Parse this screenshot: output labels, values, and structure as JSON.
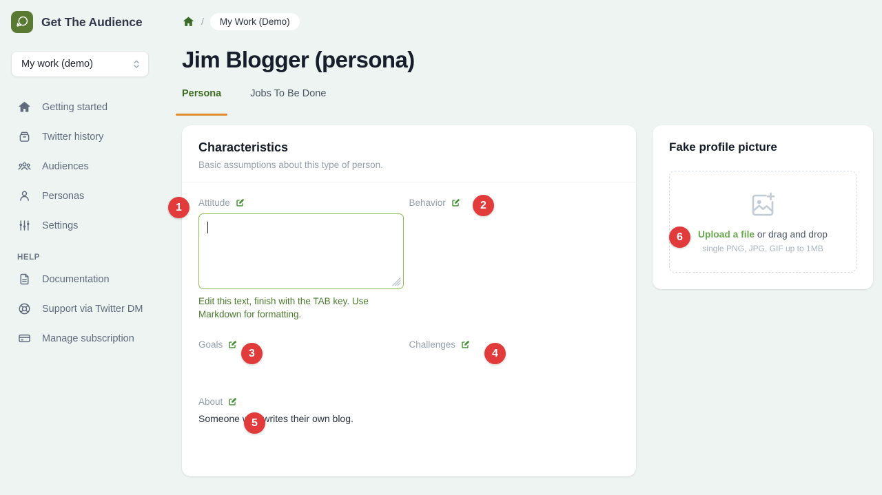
{
  "brand": {
    "name": "Get The Audience",
    "logo_icon": "speech-bubbles-icon",
    "logo_color": "#5a7a33"
  },
  "sidebar": {
    "workspace": {
      "value": "My work (demo)",
      "chevron_icon": "chevron-up-down-icon"
    },
    "items": [
      {
        "label": "Getting started",
        "icon": "home-icon"
      },
      {
        "label": "Twitter history",
        "icon": "archive-box-icon"
      },
      {
        "label": "Audiences",
        "icon": "user-group-icon"
      },
      {
        "label": "Personas",
        "icon": "user-icon"
      },
      {
        "label": "Settings",
        "icon": "adjustments-sliders-icon"
      }
    ],
    "help_heading": "HELP",
    "help_items": [
      {
        "label": "Documentation",
        "icon": "document-text-icon"
      },
      {
        "label": "Support via Twitter DM",
        "icon": "lifebuoy-icon"
      },
      {
        "label": "Manage subscription",
        "icon": "credit-card-icon"
      }
    ]
  },
  "breadcrumb": {
    "home_icon": "home-icon",
    "separator": "/",
    "current": "My Work (Demo)"
  },
  "page": {
    "title": "Jim Blogger (persona)"
  },
  "tabs": [
    {
      "label": "Persona",
      "active": true
    },
    {
      "label": "Jobs To Be Done",
      "active": false
    }
  ],
  "characteristics": {
    "title": "Characteristics",
    "subtitle": "Basic assumptions about this type of person.",
    "fields": {
      "attitude": {
        "label": "Attitude",
        "edit_icon": "edit-pencil-square-icon",
        "value": "",
        "help": "Edit this text, finish with the TAB key. Use Markdown for formatting."
      },
      "behavior": {
        "label": "Behavior",
        "edit_icon": "edit-pencil-square-icon",
        "value": ""
      },
      "goals": {
        "label": "Goals",
        "edit_icon": "edit-pencil-square-icon",
        "value": ""
      },
      "challenges": {
        "label": "Challenges",
        "edit_icon": "edit-pencil-square-icon",
        "value": ""
      },
      "about": {
        "label": "About",
        "edit_icon": "edit-pencil-square-icon",
        "value": "Someone who writes their own blog."
      }
    }
  },
  "upload_card": {
    "title": "Fake profile picture",
    "icon": "photo-add-icon",
    "link_label": "Upload a file",
    "rest_label": " or drag and drop",
    "hint": "single PNG, JPG, GIF up to 1MB"
  },
  "annotations": {
    "color": "#e13b3b",
    "badges": [
      {
        "number": "1",
        "target": "attitude-field"
      },
      {
        "number": "2",
        "target": "behavior-field"
      },
      {
        "number": "3",
        "target": "goals-field"
      },
      {
        "number": "4",
        "target": "challenges-field"
      },
      {
        "number": "5",
        "target": "about-field"
      },
      {
        "number": "6",
        "target": "upload-dropzone"
      }
    ]
  }
}
